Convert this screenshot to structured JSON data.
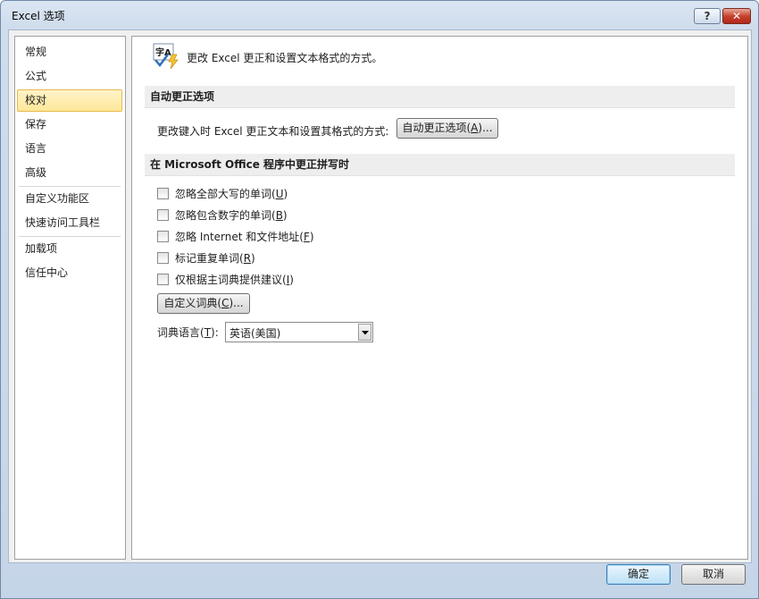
{
  "window": {
    "title": "Excel 选项",
    "help_label": "?",
    "close_label": "✕"
  },
  "sidebar": {
    "items": [
      {
        "label": "常规"
      },
      {
        "label": "公式"
      },
      {
        "label": "校对"
      },
      {
        "label": "保存"
      },
      {
        "label": "语言"
      },
      {
        "label": "高级"
      },
      {
        "label": "自定义功能区"
      },
      {
        "label": "快速访问工具栏"
      },
      {
        "label": "加载项"
      },
      {
        "label": "信任中心"
      }
    ],
    "selected": "校对"
  },
  "header": {
    "icon": "proofing-abc-check-icon",
    "icon_text": "字A",
    "text": "更改 Excel 更正和设置文本格式的方式。"
  },
  "autocorrect": {
    "title": "自动更正选项",
    "description": "更改键入时 Excel 更正文本和设置其格式的方式:",
    "button": {
      "prefix": "自动更正选项(",
      "key": "A",
      "suffix": ")..."
    }
  },
  "spelling": {
    "title": "在 Microsoft Office 程序中更正拼写时",
    "options": [
      {
        "prefix": "忽略全部大写的单词(",
        "key": "U",
        "suffix": ")",
        "checked": false
      },
      {
        "prefix": "忽略包含数字的单词(",
        "key": "B",
        "suffix": ")",
        "checked": false
      },
      {
        "prefix": "忽略 Internet 和文件地址(",
        "key": "F",
        "suffix": ")",
        "checked": false
      },
      {
        "prefix": "标记重复单词(",
        "key": "R",
        "suffix": ")",
        "checked": false
      },
      {
        "prefix": "仅根据主词典提供建议(",
        "key": "I",
        "suffix": ")",
        "checked": false
      }
    ],
    "custom_dict_button": {
      "prefix": "自定义词典(",
      "key": "C",
      "suffix": ")..."
    },
    "dictionary_language": {
      "prefix": "词典语言(",
      "key": "T",
      "suffix": "):",
      "value": "英语(美国)"
    }
  },
  "footer": {
    "ok_label": "确定",
    "cancel_label": "取消"
  },
  "colors": {
    "selected_bg": "#fde89a",
    "selected_border": "#e7b94b",
    "close_red": "#c7432e",
    "default_button": "#3c7fb1"
  }
}
